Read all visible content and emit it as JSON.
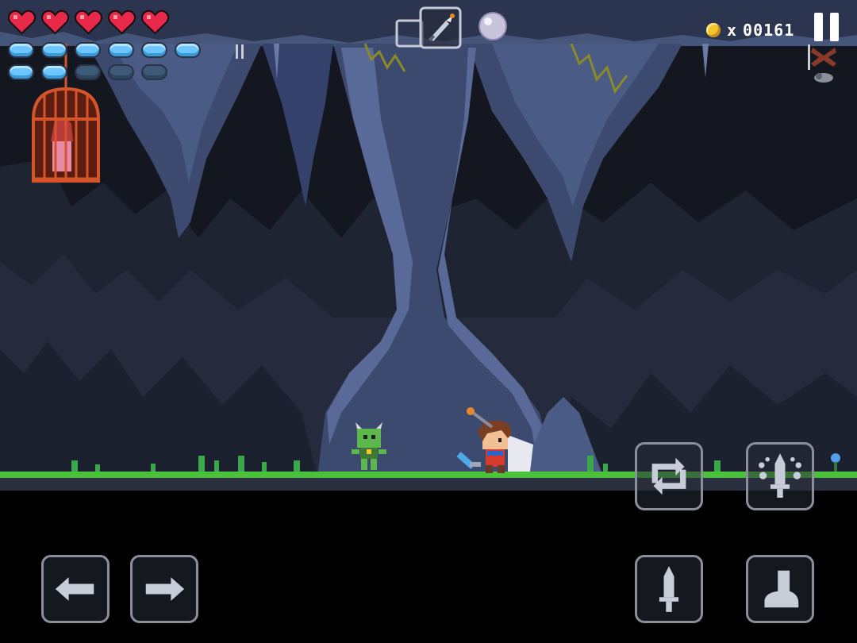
{
  "hud": {
    "hearts": {
      "filled": 5,
      "total": 5,
      "color": "#e8294a"
    },
    "mana_row1": {
      "filled": 6,
      "total": 6
    },
    "mana_row2": {
      "filled": 2,
      "total": 5
    },
    "coins": {
      "x_label": "x",
      "count": "00161"
    },
    "equipped_item": "sword-icon",
    "orb_item": "magic-orb-icon"
  },
  "controls": {
    "move_left": "arrow-left-icon",
    "move_right": "arrow-right-icon",
    "swap": "swap-icon",
    "magic": "magic-sword-icon",
    "attack": "sword-icon",
    "jump": "boot-icon"
  },
  "colors": {
    "cave_wall": "#3b4a6e",
    "cave_dark": "#1a1e2c",
    "grass": "#4cc23c",
    "ground": "#2a3040",
    "cage": "#d4552a"
  }
}
